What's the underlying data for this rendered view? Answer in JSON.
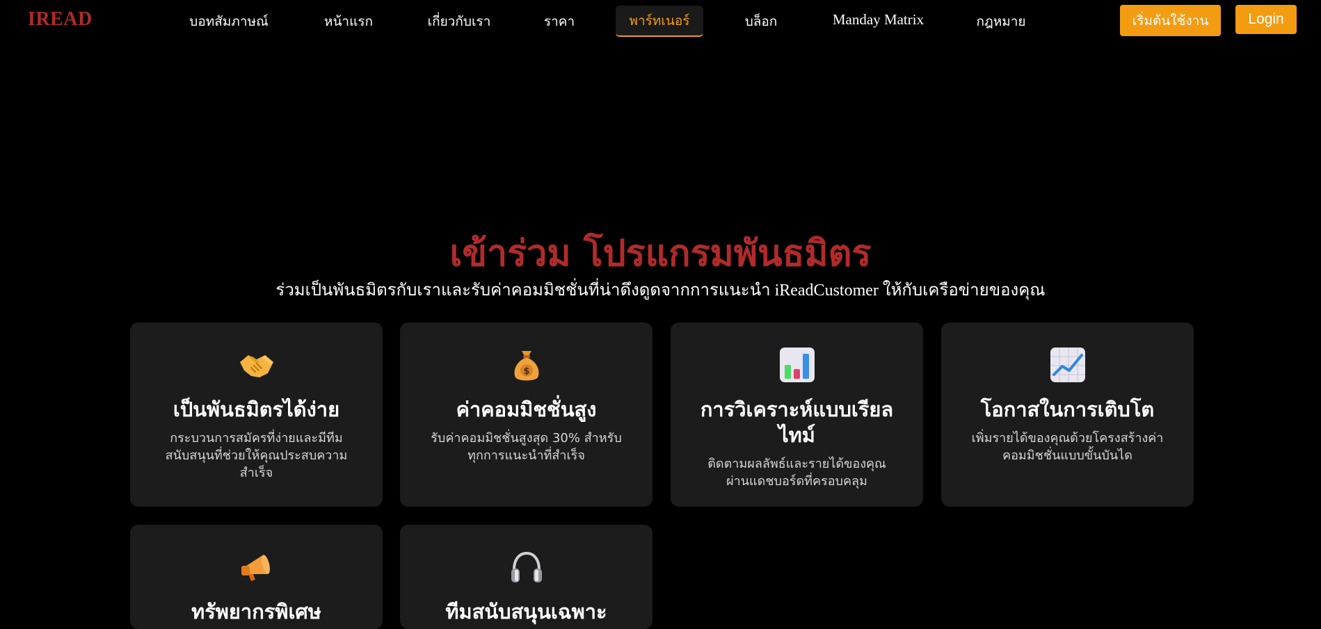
{
  "nav": {
    "logo": "IREAD",
    "links": [
      "บอทสัมภาษณ์",
      "หน้าแรก",
      "เกี่ยวกับเรา",
      "ราคา",
      "พาร์ทเนอร์",
      "บล็อก",
      "Manday Matrix",
      "กฎหมาย"
    ],
    "active_link": "พาร์ทเนอร์",
    "start_button": "เริ่มต้นใช้งาน",
    "login_button": "Login"
  },
  "hero": {
    "title": "เข้าร่วม โปรแกรมพันธมิตร",
    "subtitle": "ร่วมเป็นพันธมิตรกับเราและรับค่าคอมมิชชั่นที่น่าดึงดูดจากการแนะนำ iReadCustomer ให้กับเครือข่ายของคุณ"
  },
  "cards": [
    {
      "icon": "handshake-icon",
      "title": "เป็นพันธมิตรได้ง่าย",
      "desc": "กระบวนการสมัครที่ง่ายและมีทีมสนับสนุนที่ช่วยให้คุณประสบความสำเร็จ"
    },
    {
      "icon": "money-bag-icon",
      "title": "ค่าคอมมิชชั่นสูง",
      "desc": "รับค่าคอมมิชชั่นสูงสุด 30% สำหรับทุกการแนะนำที่สำเร็จ"
    },
    {
      "icon": "bar-chart-icon",
      "title": "การวิเคราะห์แบบเรียลไทม์",
      "desc": "ติดตามผลลัพธ์และรายได้ของคุณผ่านแดชบอร์ดที่ครอบคลุม"
    },
    {
      "icon": "growth-chart-icon",
      "title": "โอกาสในการเติบโต",
      "desc": "เพิ่มรายได้ของคุณด้วยโครงสร้างค่าคอมมิชชั่นแบบขั้นบันได"
    },
    {
      "icon": "megaphone-icon",
      "title": "ทรัพยากรพิเศษ",
      "desc": ""
    },
    {
      "icon": "headphones-icon",
      "title": "ทีมสนับสนุนเฉพาะ",
      "desc": ""
    }
  ],
  "colors": {
    "brand_red": "#b22a2a",
    "accent_orange": "#f39c12",
    "card_bg": "#1c1c1c"
  }
}
